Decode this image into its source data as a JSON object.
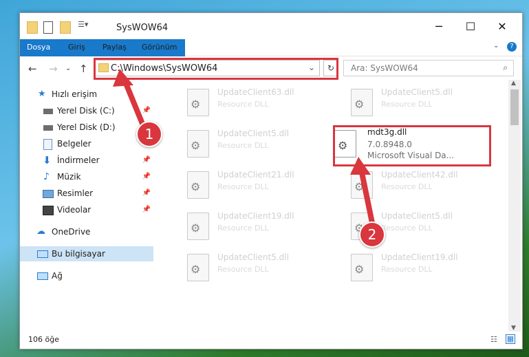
{
  "window": {
    "title": "SysWOW64"
  },
  "ribbon": {
    "tabs": [
      "Dosya",
      "Giriş",
      "Paylaş",
      "Görünüm"
    ]
  },
  "address": {
    "path": "C:\\Windows\\SysWOW64",
    "search_placeholder": "Ara: SysWOW64"
  },
  "nav": {
    "items": [
      {
        "label": "Hızlı erişim",
        "icon": "star-icon"
      },
      {
        "label": "Yerel Disk (C:)",
        "icon": "drive-icon"
      },
      {
        "label": "Yerel Disk (D:)",
        "icon": "drive-icon"
      },
      {
        "label": "Belgeler",
        "icon": "document-icon"
      },
      {
        "label": "İndirmeler",
        "icon": "download-icon"
      },
      {
        "label": "Müzik",
        "icon": "music-icon"
      },
      {
        "label": "Resimler",
        "icon": "picture-icon"
      },
      {
        "label": "Videolar",
        "icon": "video-icon"
      },
      {
        "label": "OneDrive",
        "icon": "cloud-icon"
      },
      {
        "label": "Bu bilgisayar",
        "icon": "computer-icon"
      },
      {
        "label": "Ağ",
        "icon": "network-icon"
      }
    ]
  },
  "files": [
    {
      "name": "UpdateClient63.dll",
      "type": "Resource DLL"
    },
    {
      "name": "UpdateClient5.dll",
      "type": "Resource DLL"
    },
    {
      "name": "UpdateClient5.dll",
      "type": "Resource DLL"
    },
    {
      "name": "mdt3g.dll",
      "version": "7.0.8948.0",
      "desc": "Microsoft Visual Da..."
    },
    {
      "name": "UpdateClient21.dll",
      "type": "Resource DLL"
    },
    {
      "name": "UpdateClient42.dll",
      "type": "Resource DLL"
    },
    {
      "name": "UpdateClient19.dll",
      "type": "Resource DLL"
    },
    {
      "name": "UpdateClient5.dll",
      "type": "Resource DLL"
    },
    {
      "name": "UpdateClient5.dll",
      "type": "Resource DLL"
    },
    {
      "name": "UpdateClient19.dll",
      "type": "Resource DLL"
    }
  ],
  "status": {
    "count": "106 öğe"
  },
  "annotations": {
    "step1": "1",
    "step2": "2"
  },
  "colors": {
    "accent": "#1979ca",
    "highlight": "#d9363e"
  }
}
